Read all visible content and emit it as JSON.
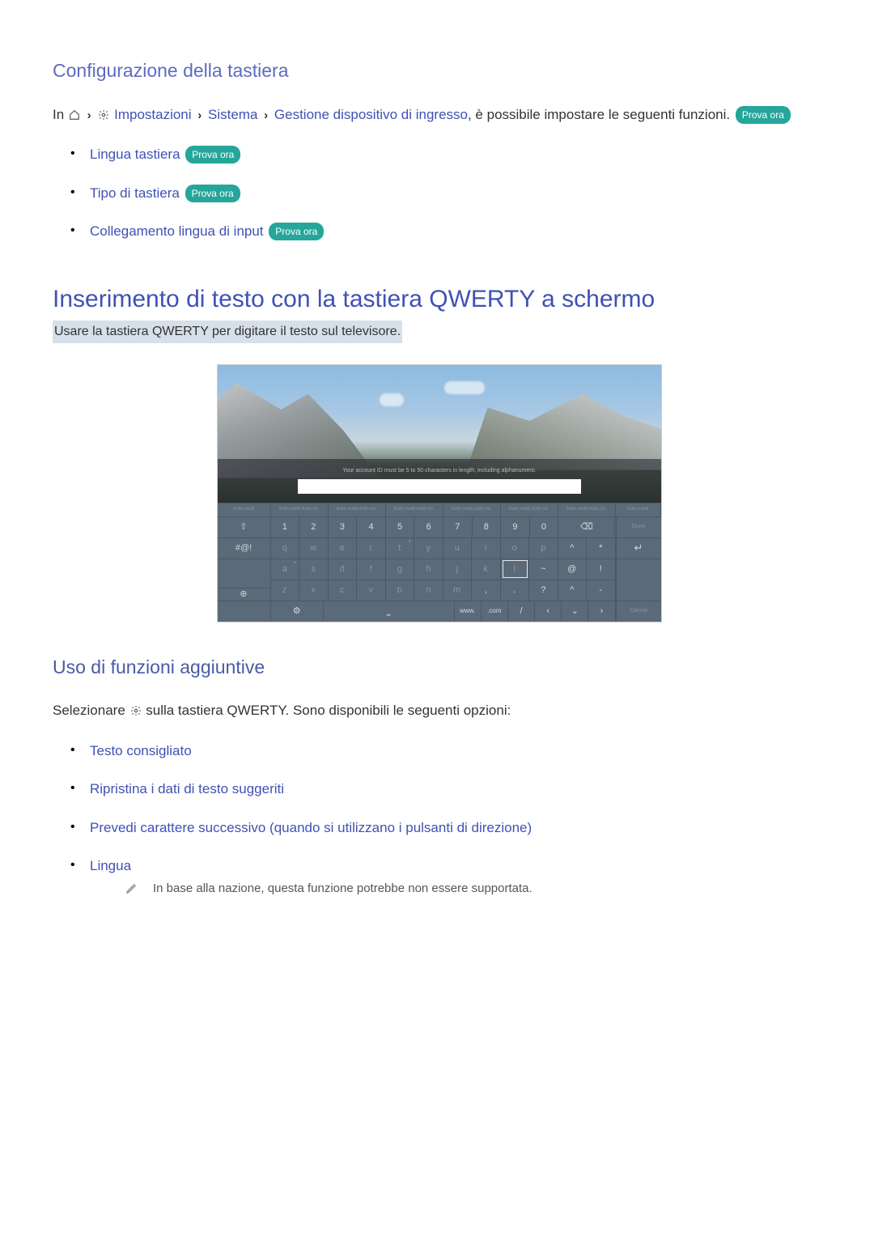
{
  "section1": {
    "title": "Configurazione della tastiera",
    "intro_prefix": "In ",
    "path": {
      "impostazioni": "Impostazioni",
      "sistema": "Sistema",
      "gestione": "Gestione dispositivo di ingresso"
    },
    "intro_suffix": ", è possibile impostare le seguenti funzioni.",
    "try_now": "Prova ora",
    "items": [
      {
        "label": "Lingua tastiera",
        "badge": "Prova ora"
      },
      {
        "label": "Tipo di tastiera",
        "badge": "Prova ora"
      },
      {
        "label": "Collegamento lingua di input",
        "badge": "Prova ora"
      }
    ]
  },
  "main_heading": "Inserimento di testo con la tastiera QWERTY a schermo",
  "subtitle": "Usare la tastiera QWERTY per digitare il testo sul televisore.",
  "figure": {
    "suggest_placeholder": "Auto vuoti Auto vo.",
    "row_numbers": [
      "1",
      "2",
      "3",
      "4",
      "5",
      "6",
      "7",
      "8",
      "9",
      "0"
    ],
    "row_sym1": [
      "~",
      "@",
      "!"
    ],
    "row_sym2": [
      "?",
      "^",
      "-"
    ],
    "row_bottom": [
      "www.",
      ".com",
      "/",
      "‹",
      "⌄",
      "›"
    ],
    "side": {
      "shift": "⇧",
      "sym": "#@!",
      "globe": "⊕"
    },
    "right": {
      "done": "Done",
      "enter": "↵",
      "cancel": "Cancel"
    },
    "backspace": "⌫",
    "space": "⎵",
    "gear": "⚙"
  },
  "section2": {
    "title": "Uso di funzioni aggiuntive",
    "intro_prefix": "Selezionare ",
    "intro_suffix": " sulla tastiera QWERTY. Sono disponibili le seguenti opzioni:",
    "items": [
      "Testo consigliato",
      "Ripristina i dati di testo suggeriti",
      "Prevedi carattere successivo (quando si utilizzano i pulsanti di direzione)",
      "Lingua"
    ],
    "note": "In base alla nazione, questa funzione potrebbe non essere supportata."
  }
}
